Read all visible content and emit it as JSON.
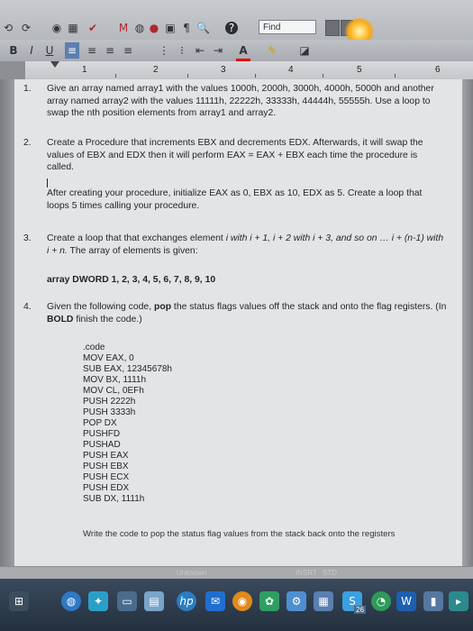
{
  "toolbar": {
    "find_label": "Find",
    "bold_label": "B",
    "italic_label": "I",
    "underline_label": "U",
    "font_color_label": "A"
  },
  "ruler": {
    "numbers": [
      "1",
      "2",
      "3",
      "4",
      "5",
      "6"
    ]
  },
  "items": [
    {
      "number": "1.",
      "text": "Give an array named array1 with the values 1000h, 2000h, 3000h, 4000h, 5000h and another array named array2 with the values 11111h, 22222h, 33333h, 44444h, 55555h. Use a loop to swap the nth position elements from array1 and array2."
    },
    {
      "number": "2.",
      "text": "Create a Procedure that increments EBX and decrements EDX. Afterwards, it will swap the values of EBX and EDX then it will perform EAX = EAX + EBX each time the procedure is called.",
      "text2": "After creating your procedure, initialize EAX as 0, EBX as 10, EDX as 5. Create a loop that loops 5 times calling your procedure."
    },
    {
      "number": "3.",
      "text_a": "Create a loop that that exchanges element ",
      "text_b": "i with i + 1, i + 2 with i + 3, and so on …",
      "text_c": "i + (n-1) with i + n.",
      "text_d": " The array of elements is given:",
      "array_line": "array DWORD 1, 2, 3, 4, 5, 6, 7, 8, 9, 10"
    },
    {
      "number": "4.",
      "text_a": "Given the following code, ",
      "text_b": "pop",
      "text_c": " the status flags values off the stack and onto the flag registers. (In ",
      "text_d": "BOLD",
      "text_e": " finish the code.)"
    }
  ],
  "code_lines": [
    ".code",
    "MOV EAX, 0",
    "SUB EAX, 12345678h",
    "MOV BX, 1111h",
    "MOV CL, 0EFh",
    "PUSH 2222h",
    "PUSH 3333h",
    "POP DX",
    "PUSHFD",
    "PUSHAD",
    "PUSH EAX",
    "PUSH EBX",
    "PUSH ECX",
    "PUSH EDX",
    "SUB DX, 1111h"
  ],
  "final_line": "Write the code to pop the status flag values from the stack back onto the registers",
  "status": {
    "left": "Unknown",
    "insrt": "INSRT",
    "std": "STD"
  },
  "taskbar": {
    "badge": "26"
  },
  "colors": {
    "page": "#e3e4e6",
    "taskbar": "#23303f",
    "toolbar": "#c9cbcf",
    "glare": "#f6a81a"
  }
}
